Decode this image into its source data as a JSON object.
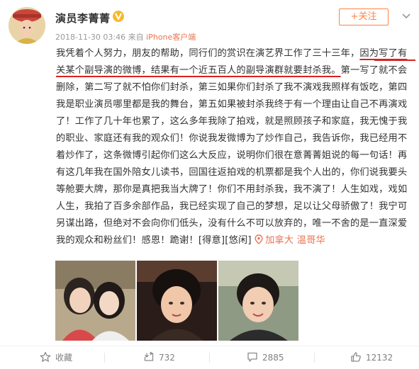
{
  "post": {
    "author": "演员李菁菁",
    "time": "2018-11-30 03:46",
    "source_prefix": "来自",
    "source": "iPhone客户端",
    "follow_label": "+关注",
    "text": {
      "part1": "我凭着个人努力，朋友的帮助，同行们的赏识在演艺界工作了三十三年，",
      "underlined": "因为写了有关某个副导演的微博，结果有一个近五百人的副导演群就要封杀我。",
      "part2": "第一写了就不会删除，第二写了就不怕你们封杀，第三如果你们封杀了我不演戏我照样有饭吃，第四我是职业演员哪里都是我的舞台，第五如果被封杀我终于有一个理由让自己不再演戏了！工作了几十年也累了，这么多年我除了拍戏，就是照顾孩子和家庭，我无愧于我的职业、家庭还有我的观众们！你说我发微博为了炒作自己，我告诉你，我已经用不着炒作了，这条微博引起你们这么大反应，说明你们很在意菁菁姐说的每一句话！再有这几年我在国外陪女儿读书，回国往返拍戏的机票都是我个人出的，你们说我要头等舱要大牌，那你是真把我当大牌了！你们不用封杀我，我不演了！人生如戏，戏如人生，我拍了百多余部作品，我已经实现了自己的梦想，足以让父母骄傲了！我宁可另谋出路，但绝对不会向你们低头，没有什么不可以放弃的，唯一不舍的是一直深爱我的观众和粉丝们！感恩！跪谢！",
      "emoji1": "[得意]",
      "emoji2": "[悠闲]",
      "location": "加拿大 温哥华"
    }
  },
  "footer": {
    "favorite_label": "收藏",
    "repost_count": "732",
    "comment_count": "2885",
    "like_count": "12132"
  },
  "colors": {
    "source_link": "#eb7350",
    "follow": "#ff8140",
    "annotation_red": "#d8231f",
    "verified": "#f6b92b"
  }
}
